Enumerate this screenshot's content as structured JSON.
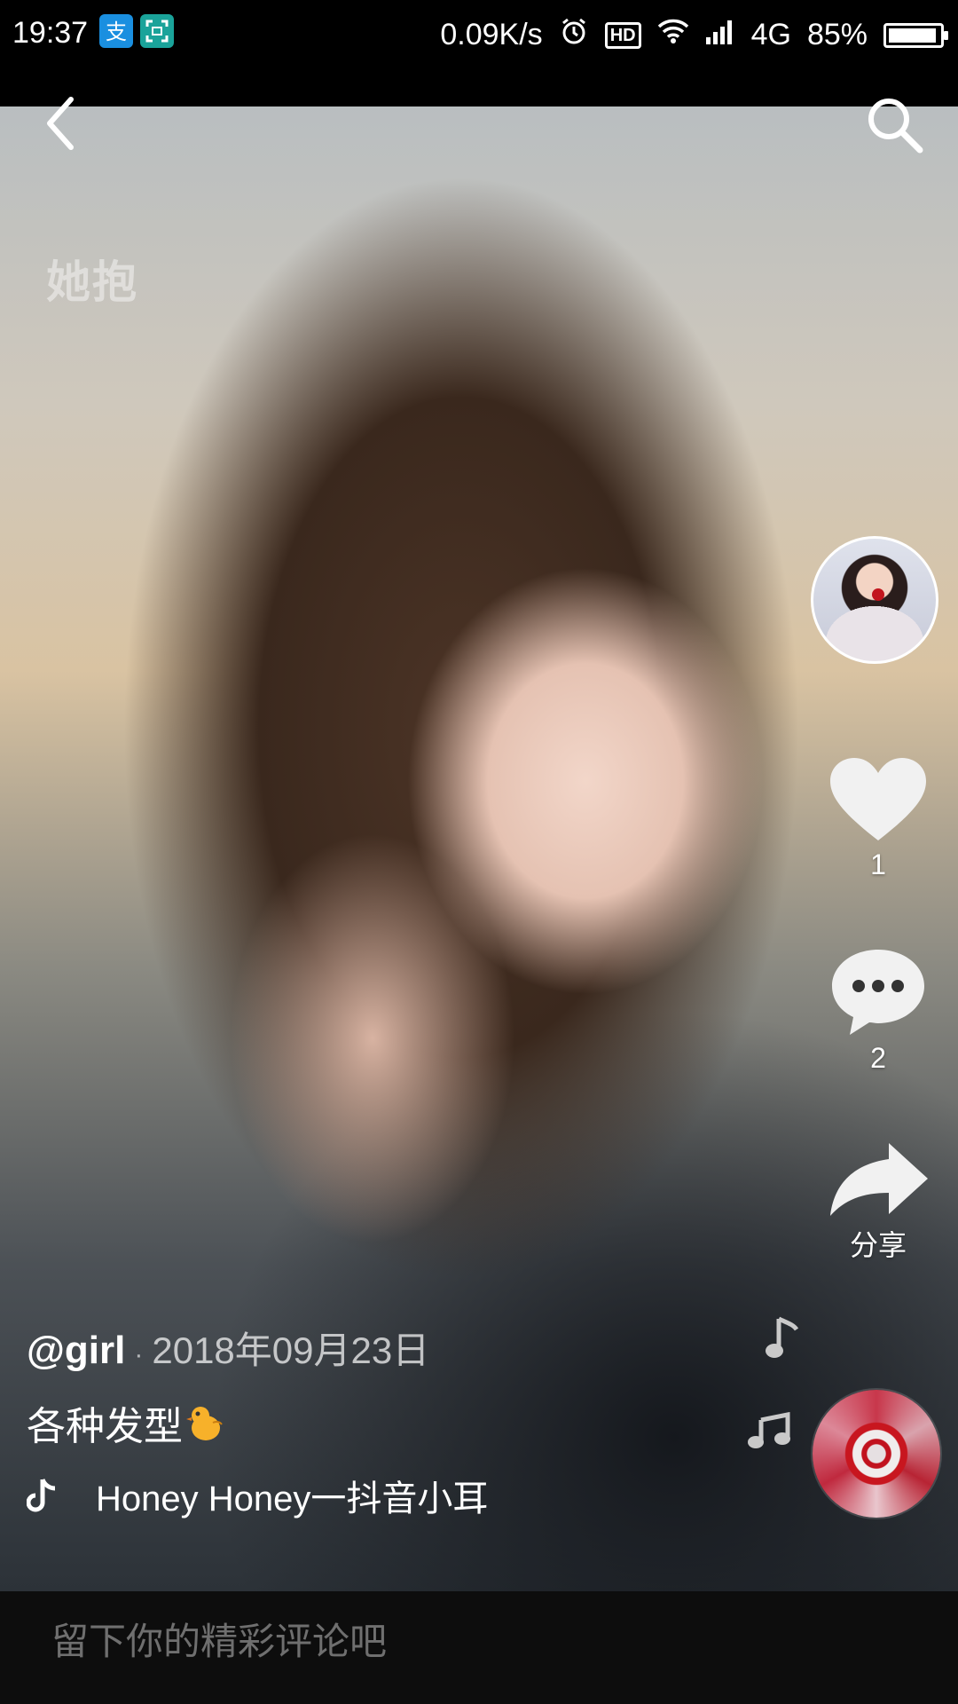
{
  "status_bar": {
    "time": "19:37",
    "network_speed": "0.09K/s",
    "hd_label": "HD",
    "network_type": "4G",
    "battery_percent": "85%",
    "battery_level": 0.85
  },
  "video": {
    "watermark": "她抱"
  },
  "actions": {
    "like_count": "1",
    "comment_count": "2",
    "share_label": "分享"
  },
  "post": {
    "username": "@girl",
    "separator": "·",
    "date": "2018年09月23日",
    "caption": "各种发型",
    "music_title": "Honey Honey一抖音小耳"
  },
  "comment_bar": {
    "placeholder": "留下你的精彩评论吧"
  },
  "colors": {
    "background": "#000000",
    "comment_bar": "#0d0d0d",
    "alipay_blue": "#1a8fe0",
    "scan_teal": "#1aa39a",
    "disc_red": "#c8374b"
  },
  "icons": [
    "back-arrow-icon",
    "search-icon",
    "heart-icon",
    "comment-bubble-icon",
    "share-arrow-icon",
    "music-note-icon",
    "double-note-icon",
    "tiktok-note-icon"
  ]
}
